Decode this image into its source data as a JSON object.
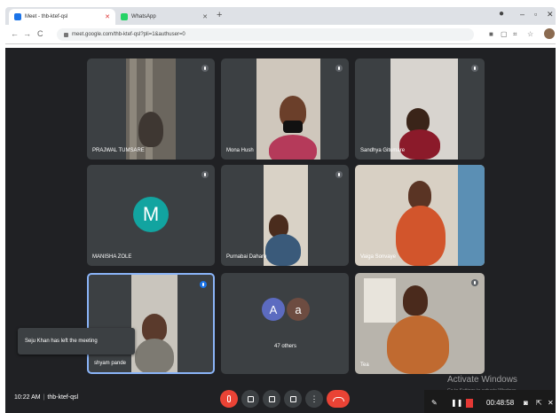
{
  "browser": {
    "tabs": [
      {
        "label": "Meet - thb-ktef-qsl",
        "active": true,
        "favicon_color": "#1a73e8"
      },
      {
        "label": "WhatsApp",
        "active": false,
        "favicon_color": "#25d366"
      }
    ],
    "new_tab_label": "+",
    "url": "meet.google.com/thb-ktef-qsl?pli=1&authuser=0",
    "window_controls": {
      "minimize": "–",
      "maximize": "▫",
      "close": "✕"
    },
    "nav": {
      "back": "←",
      "forward": "→",
      "reload": "C"
    }
  },
  "meet": {
    "participants": [
      {
        "name": "PRAJWAL TUMSARE",
        "type": "video"
      },
      {
        "name": "Mona Hush",
        "type": "video"
      },
      {
        "name": "Sandhya Gitumare",
        "type": "video"
      },
      {
        "name": "MANISHA ZOLE",
        "type": "avatar",
        "initial": "M",
        "avatar_color": "#12a4a0"
      },
      {
        "name": "Purnabai Dahare",
        "type": "video"
      },
      {
        "name": "Vaiga Sonvaye",
        "type": "video"
      },
      {
        "name": "shyam pande",
        "type": "video",
        "active_speaker": true
      },
      {
        "name": "47 others",
        "type": "others",
        "initials": [
          "A",
          "a"
        ],
        "colors": [
          "#5c6bc0",
          "#6d4c41"
        ]
      },
      {
        "name": "Tea",
        "type": "video"
      }
    ],
    "toast": "Seju Khan has left the meeting",
    "meeting_time": "10:22 AM",
    "meeting_code": "thb-ktef-qsl",
    "controls": [
      "mic-off",
      "camera",
      "captions",
      "present",
      "more",
      "end-call"
    ]
  },
  "windows_overlay": {
    "activate_title": "Activate Windows",
    "activate_sub": "Go to Settings to activate Windows.",
    "recording_timer": "00:48:58"
  },
  "colors": {
    "meet_bg": "#202124",
    "tile_bg": "#3c4043",
    "end_red": "#ea4335",
    "active_border": "#8ab4f8"
  }
}
